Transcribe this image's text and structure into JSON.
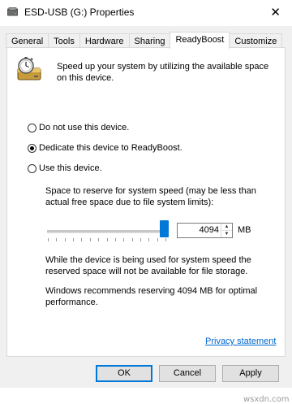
{
  "window": {
    "title": "ESD-USB (G:) Properties",
    "close_glyph": "✕"
  },
  "tabs": [
    {
      "label": "General",
      "active": false
    },
    {
      "label": "Tools",
      "active": false
    },
    {
      "label": "Hardware",
      "active": false
    },
    {
      "label": "Sharing",
      "active": false
    },
    {
      "label": "ReadyBoost",
      "active": true
    },
    {
      "label": "Customize",
      "active": false
    }
  ],
  "readyboost": {
    "icon": "readyboost-icon",
    "intro": "Speed up your system by utilizing the available space on this device.",
    "options": [
      {
        "label": "Do not use this device.",
        "checked": false
      },
      {
        "label": "Dedicate this device to ReadyBoost.",
        "checked": true
      },
      {
        "label": "Use this device.",
        "checked": false
      }
    ],
    "reserve_label": "Space to reserve for system speed (may be less than actual free space due to file system limits):",
    "slider_fraction": 1.0,
    "reserve_value": "4094",
    "unit": "MB",
    "storage_note": "While the device is being used for system speed the reserved space will not be available for file storage.",
    "recommendation": "Windows recommends reserving 4094 MB for optimal performance.",
    "privacy_link": "Privacy statement"
  },
  "buttons": {
    "ok": "OK",
    "cancel": "Cancel",
    "apply": "Apply"
  },
  "watermark": "wsxdn.com",
  "colors": {
    "accent": "#0078d7",
    "link": "#0066cc"
  }
}
